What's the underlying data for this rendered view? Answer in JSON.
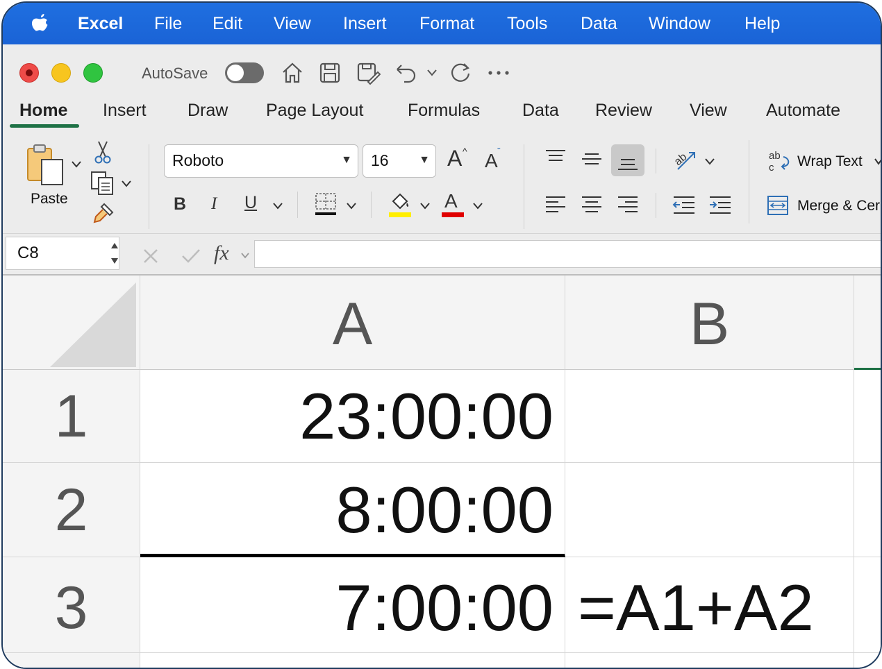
{
  "menubar": {
    "app_name": "Excel",
    "items": [
      "File",
      "Edit",
      "View",
      "Insert",
      "Format",
      "Tools",
      "Data",
      "Window",
      "Help"
    ]
  },
  "titlebar": {
    "autosave_label": "AutoSave",
    "autosave_on": false
  },
  "ribbon_tabs": {
    "active": "Home",
    "items": [
      "Home",
      "Insert",
      "Draw",
      "Page Layout",
      "Formulas",
      "Data",
      "Review",
      "View",
      "Automate"
    ]
  },
  "ribbon": {
    "paste_label": "Paste",
    "font_name": "Roboto",
    "font_size": "16",
    "bold_glyph": "B",
    "italic_glyph": "I",
    "underline_glyph": "U",
    "grow_font_glyph": "A",
    "shrink_font_glyph": "A",
    "font_color_glyph": "A",
    "wrap_text_label": "Wrap Text",
    "merge_label": "Merge & Cer",
    "highlight_color": "#ffee00",
    "font_color": "#e00000"
  },
  "formula_bar": {
    "name_box": "C8",
    "fx_label": "fx",
    "formula": ""
  },
  "sheet": {
    "columns": [
      "A",
      "B"
    ],
    "rows": [
      {
        "number": "1",
        "a": "23:00:00",
        "b": ""
      },
      {
        "number": "2",
        "a": "8:00:00",
        "b": ""
      },
      {
        "number": "3",
        "a": "7:00:00",
        "b": "=A1+A2"
      }
    ]
  }
}
